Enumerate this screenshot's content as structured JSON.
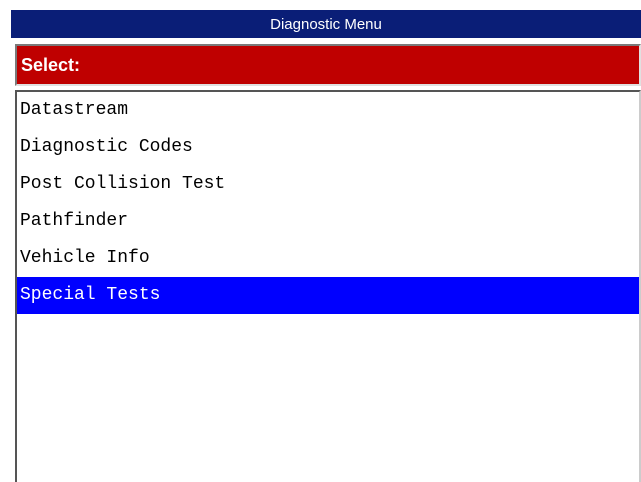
{
  "window": {
    "title": "Diagnostic Menu"
  },
  "prompt": {
    "label": "Select:"
  },
  "menu": {
    "items": [
      {
        "label": "Datastream",
        "selected": false
      },
      {
        "label": "Diagnostic Codes",
        "selected": false
      },
      {
        "label": "Post Collision Test",
        "selected": false
      },
      {
        "label": "Pathfinder",
        "selected": false
      },
      {
        "label": "Vehicle Info",
        "selected": false
      },
      {
        "label": "Special Tests",
        "selected": true
      }
    ]
  },
  "colors": {
    "title_bar": "#0a1e77",
    "prompt_bar": "#bf0000",
    "selection": "#0000ff"
  }
}
